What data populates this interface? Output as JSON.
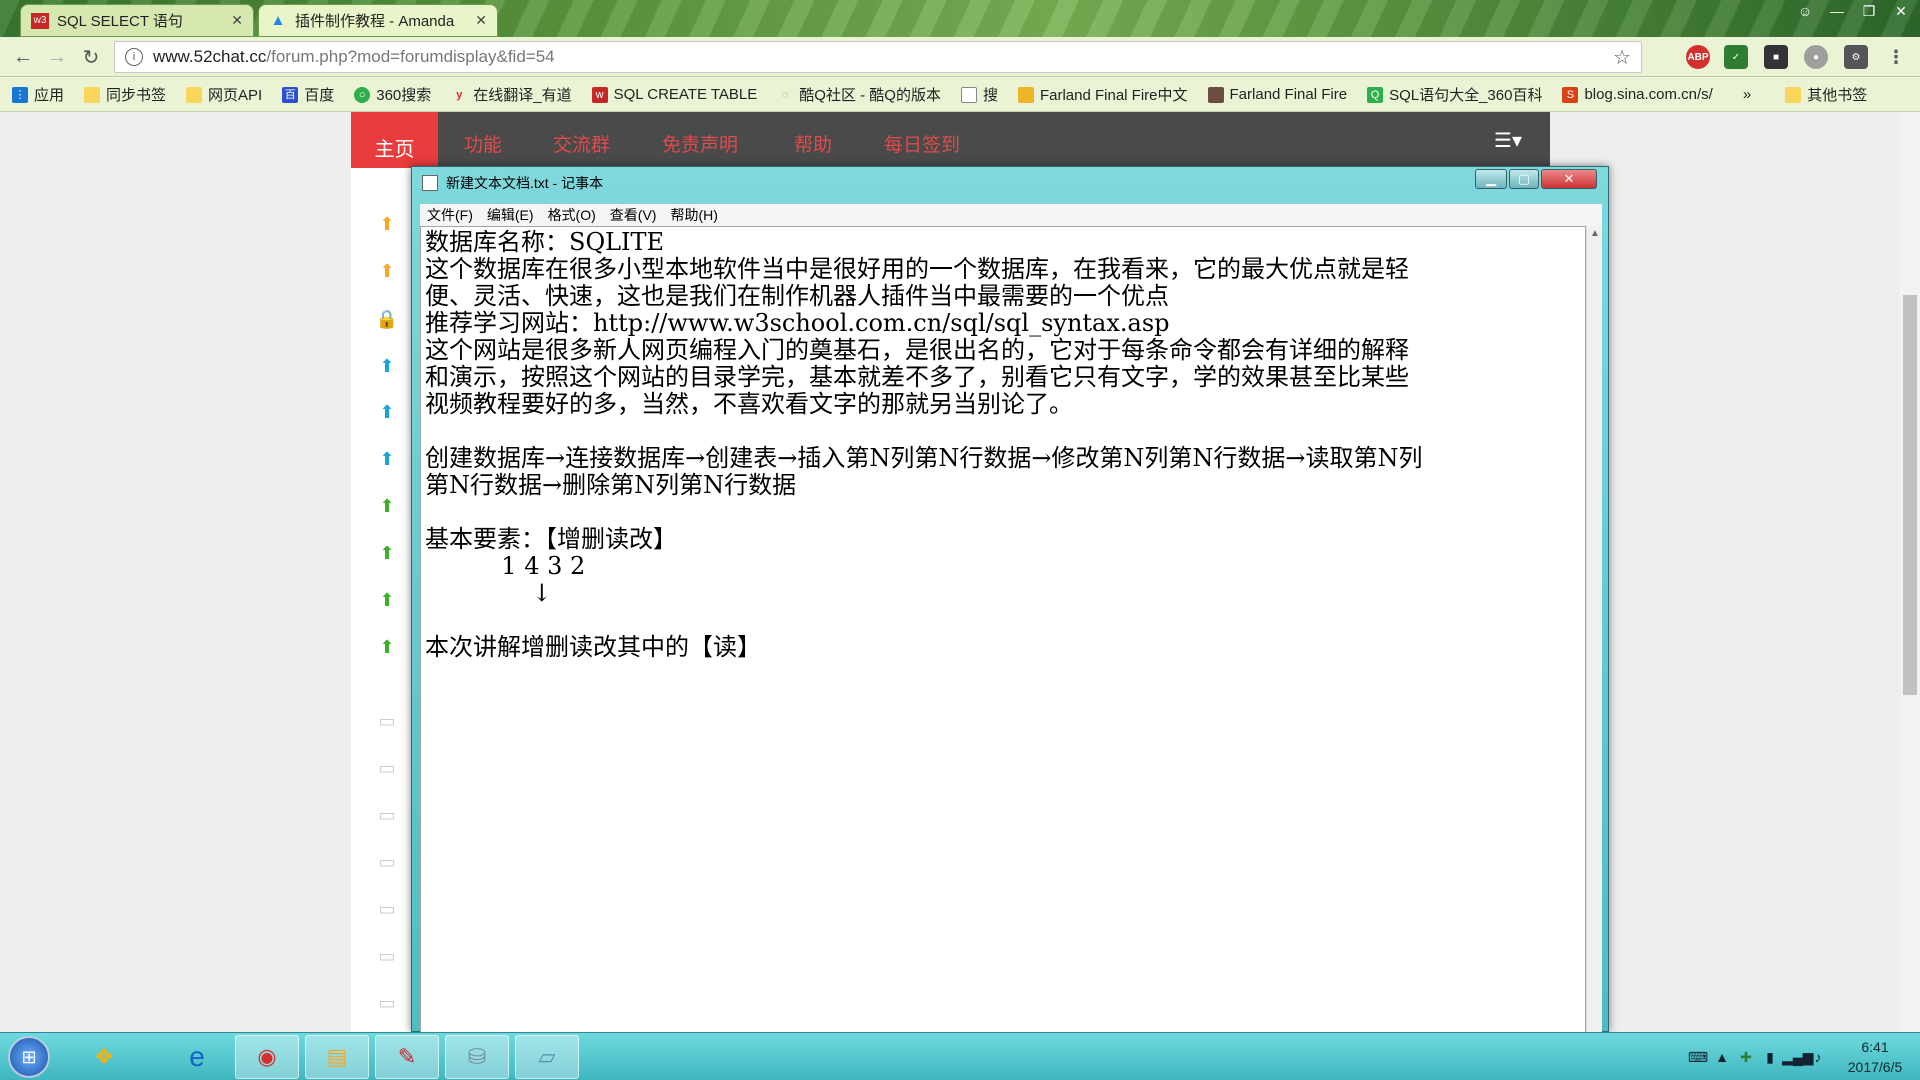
{
  "browser": {
    "tabs": [
      {
        "label": "SQL SELECT 语句",
        "favicon": "w3"
      },
      {
        "label": "插件制作教程 - Amanda",
        "favicon": "a"
      }
    ],
    "url_host": "www.52chat.cc",
    "url_path": "/forum.php?mod=forumdisplay&fid=54",
    "bookmarks": [
      "应用",
      "同步书签",
      "网页API",
      "百度",
      "360搜索",
      "在线翻译_有道",
      "SQL CREATE TABLE",
      "酷Q社区 - 酷Q的版本",
      "搜",
      "Farland Final Fire中文",
      "Farland Final Fire",
      "SQL语句大全_360百科",
      "blog.sina.com.cn/s/",
      "»",
      "其他书签"
    ]
  },
  "site_nav": {
    "items": [
      "主页",
      "功能",
      "交流群",
      "免责声明",
      "帮助",
      "每日签到"
    ]
  },
  "notepad": {
    "title": "新建文本文档.txt - 记事本",
    "menu": [
      "文件(F)",
      "编辑(E)",
      "格式(O)",
      "查看(V)",
      "帮助(H)"
    ],
    "content": "数据库名称：SQLITE\n这个数据库在很多小型本地软件当中是很好用的一个数据库，在我看来，它的最大优点就是轻\n便、灵活、快速，这也是我们在制作机器人插件当中最需要的一个优点\n推荐学习网站：http://www.w3school.com.cn/sql/sql_syntax.asp\n这个网站是很多新人网页编程入门的奠基石，是很出名的，它对于每条命令都会有详细的解释\n和演示，按照这个网站的目录学完，基本就差不多了，别看它只有文字，学的效果甚至比某些\n视频教程要好的多，当然，不喜欢看文字的那就另当别论了。\n\n创建数据库→连接数据库→创建表→插入第N列第N行数据→修改第N列第N行数据→读取第N列\n第N行数据→删除第N列第N行数据\n\n基本要素：【增删读改】\n          1 4 3 2\n              ↓\n\n本次讲解增删读改其中的【读】"
  },
  "taskbar": {
    "apps": [
      "ms-store-icon",
      "ie-icon",
      "chrome-icon",
      "explorer-icon",
      "paint-icon",
      "db-icon",
      "notepad-icon"
    ],
    "time": "6:41",
    "date": "2017/6/5"
  }
}
